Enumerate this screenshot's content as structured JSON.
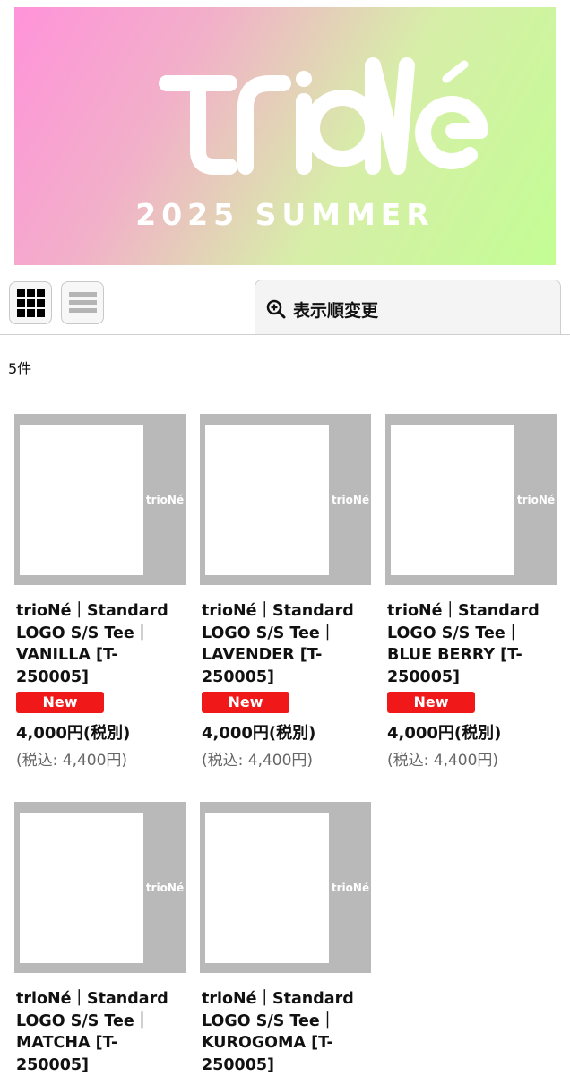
{
  "banner": {
    "logo_text": "trioNé",
    "subtitle": "2025 SUMMER"
  },
  "toolbar": {
    "grid_view_icon": "grid-view-icon",
    "list_view_icon": "list-view-icon",
    "sort_icon": "zoom-in-icon",
    "sort_label": "表示順変更"
  },
  "result_count": "5件",
  "products": [
    {
      "name": "trioNé｜Standard\nLOGO S/S Tee｜\nVANILLA [T-\n250005]",
      "badge": "New",
      "price": "4,000円(税別)",
      "price_tax": "(税込: 4,400円)",
      "shirt_color": "#fbe79a",
      "logo_color": "#ffffff",
      "brand_tag": "trioNé"
    },
    {
      "name": "trioNé｜Standard\nLOGO S/S Tee｜\nLAVENDER [T-\n250005]",
      "badge": "New",
      "price": "4,000円(税別)",
      "price_tax": "(税込: 4,400円)",
      "shirt_color": "#bba6ef",
      "logo_color": "#ffffff",
      "brand_tag": "trioNé"
    },
    {
      "name": "trioNé｜Standard\nLOGO S/S Tee｜\nBLUE BERRY [T-\n250005]",
      "badge": "New",
      "price": "4,000円(税別)",
      "price_tax": "(税込: 4,400円)",
      "shirt_color": "#5b8ede",
      "logo_color": "#ffffff",
      "brand_tag": "trioNé"
    },
    {
      "name": "trioNé｜Standard\nLOGO S/S Tee｜\nMATCHA [T-\n250005]",
      "badge": "",
      "price": "",
      "price_tax": "",
      "shirt_color": "#7b9469",
      "logo_color": "#111111",
      "brand_tag": "trioNé"
    },
    {
      "name": "trioNé｜Standard\nLOGO S/S Tee｜\nKUROGOMA [T-\n250005]",
      "badge": "",
      "price": "",
      "price_tax": "",
      "shirt_color": "#5a5d5a",
      "logo_color": "#111111",
      "brand_tag": "trioNé"
    }
  ]
}
